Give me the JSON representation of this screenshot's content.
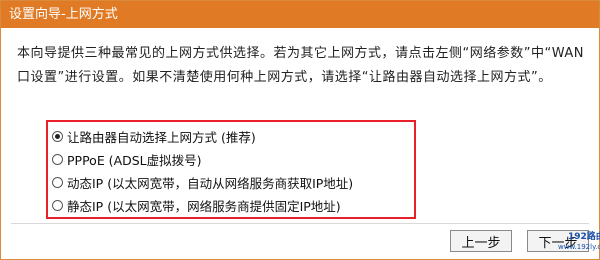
{
  "window": {
    "title": "设置向导-上网方式"
  },
  "description": "本向导提供三种最常见的上网方式供选择。若为其它上网方式，请点击左侧“网络参数”中“WAN口设置”进行设置。如果不清楚使用何种上网方式，请选择“让路由器自动选择上网方式”。",
  "options": [
    {
      "label": "让路由器自动选择上网方式 (推荐)",
      "selected": true
    },
    {
      "label": "PPPoE (ADSL虚拟拨号)",
      "selected": false
    },
    {
      "label": "动态IP (以太网宽带，自动从网络服务商获取IP地址)",
      "selected": false
    },
    {
      "label": "静态IP (以太网宽带，网络服务商提供固定IP地址)",
      "selected": false
    }
  ],
  "buttons": {
    "prev": "上一步",
    "next": "下一步"
  },
  "watermark": {
    "text": "192路由网",
    "sub": "www.192ly.com"
  },
  "colors": {
    "title_bar": "#e07a24",
    "highlight_border": "#e8202a"
  }
}
